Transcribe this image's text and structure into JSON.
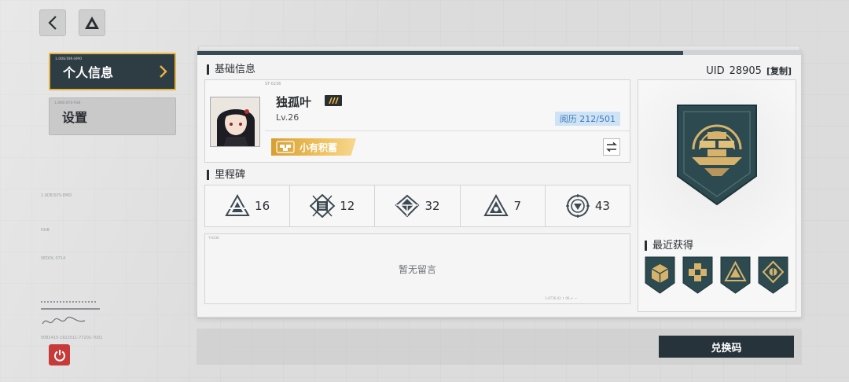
{
  "menu": {
    "items": [
      {
        "label": "个人信息",
        "tiny": "1.0DE/DIR-EMO",
        "active": true
      },
      {
        "label": "设置",
        "tiny": "1.0DE/SYS-TGB",
        "active": false
      }
    ]
  },
  "profile": {
    "section_title": "基础信息",
    "uid_label": "UID",
    "uid_value": "28905",
    "copy_label": "[复制]",
    "box_tag": "ST-0236",
    "name": "独孤叶",
    "level": "Lv.26",
    "exp_label": "阅历 212/501",
    "title_badge": "小有积蓄"
  },
  "milestones": {
    "section_title": "里程碑",
    "items": [
      {
        "icon": "milestone-triangle-icon",
        "value": "16"
      },
      {
        "icon": "milestone-grid-icon",
        "value": "12"
      },
      {
        "icon": "milestone-arrows-icon",
        "value": "32"
      },
      {
        "icon": "milestone-pyramid-icon",
        "value": "7"
      },
      {
        "icon": "milestone-target-icon",
        "value": "43"
      }
    ]
  },
  "message": {
    "empty_text": "暂无留言",
    "tag": "T-0236",
    "footer": "1-0776   03 ↑   06 ✔   —"
  },
  "badges": {
    "recent_title": "最近获得",
    "recent_icons": [
      "gold-cube-badge-icon",
      "gold-cross-badge-icon",
      "gold-pyramid-badge-icon",
      "gold-diamond-badge-icon"
    ],
    "colors": {
      "shield": "#2c4a4f",
      "gold": "#d6b26a"
    }
  },
  "deco": {
    "code1": "1.0DE/SYS-EMO",
    "code2": "HUB",
    "code3": "SEDOL 0714",
    "code4": "0082415-1922511-77201-7001"
  },
  "redeem_label": "兑换码",
  "colors": {
    "accent": "#e8b440",
    "dark": "#2e3c44",
    "power": "#c73a3a"
  }
}
